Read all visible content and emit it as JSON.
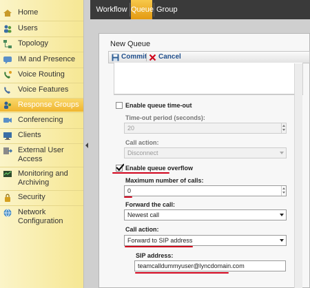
{
  "sidebar": {
    "items": [
      {
        "label": "Home",
        "icon": "home-icon"
      },
      {
        "label": "Users",
        "icon": "users-icon"
      },
      {
        "label": "Topology",
        "icon": "topology-icon"
      },
      {
        "label": "IM and Presence",
        "icon": "im-presence-icon"
      },
      {
        "label": "Voice Routing",
        "icon": "voice-routing-icon"
      },
      {
        "label": "Voice Features",
        "icon": "voice-features-icon"
      },
      {
        "label": "Response Groups",
        "icon": "response-groups-icon",
        "active": true
      },
      {
        "label": "Conferencing",
        "icon": "conferencing-icon"
      },
      {
        "label": "Clients",
        "icon": "clients-icon"
      },
      {
        "label": "External User Access",
        "icon": "external-access-icon"
      },
      {
        "label": "Monitoring and Archiving",
        "icon": "monitoring-icon"
      },
      {
        "label": "Security",
        "icon": "security-icon"
      },
      {
        "label": "Network Configuration",
        "icon": "network-icon"
      }
    ]
  },
  "tabs": {
    "workflow": "Workflow",
    "queue": "Queue",
    "group": "Group",
    "active": "Queue"
  },
  "panel": {
    "title": "New Queue",
    "commit_label": "Commit",
    "cancel_label": "Cancel"
  },
  "form": {
    "timeout_checkbox_label": "Enable queue time-out",
    "timeout_checked": false,
    "timeout_period_label": "Time-out period (seconds):",
    "timeout_period_value": "20",
    "timeout_call_action_label": "Call action:",
    "timeout_call_action_value": "Disconnect",
    "overflow_checkbox_label": "Enable queue overflow",
    "overflow_checked": true,
    "max_calls_label": "Maximum number of calls:",
    "max_calls_value": "0",
    "forward_label": "Forward the call:",
    "forward_value": "Newest call",
    "overflow_call_action_label": "Call action:",
    "overflow_call_action_value": "Forward to SIP address",
    "sip_label": "SIP address:",
    "sip_value": "teamcalldummyuser@lyncdomain.com"
  },
  "colors": {
    "sidebar": "#f6e793",
    "active_item": "#f0b52f",
    "topbar": "#3a3a3a",
    "annotation": "#d0021b",
    "link_blue": "#1f4e8c"
  }
}
